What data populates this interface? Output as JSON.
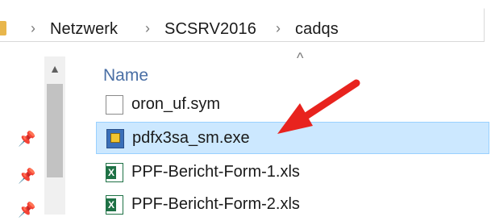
{
  "breadcrumb": {
    "items": [
      {
        "label": "Netzwerk"
      },
      {
        "label": "SCSRV2016"
      },
      {
        "label": "cadqs"
      }
    ]
  },
  "file_list": {
    "column_header": "Name",
    "files": [
      {
        "name": "oron_uf.sym",
        "icon": "document-icon",
        "selected": false
      },
      {
        "name": "pdfx3sa_sm.exe",
        "icon": "exe-icon",
        "selected": true
      },
      {
        "name": "PPF-Bericht-Form-1.xls",
        "icon": "excel-icon",
        "selected": false
      },
      {
        "name": "PPF-Bericht-Form-2.xls",
        "icon": "excel-icon",
        "selected": false
      }
    ]
  },
  "annotation": {
    "arrow_color": "#e8231e"
  },
  "colors": {
    "selection_background": "#cce8ff",
    "selection_border": "#99d1ff",
    "header_text": "#4a6fa5"
  }
}
